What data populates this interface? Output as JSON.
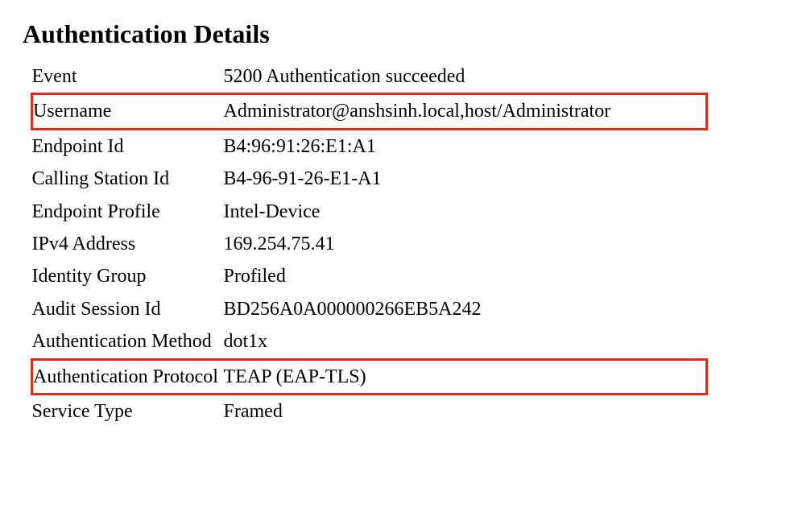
{
  "title": "Authentication Details",
  "rows": {
    "event": {
      "label": "Event",
      "value": "5200 Authentication succeeded"
    },
    "username": {
      "label": "Username",
      "value": "Administrator@anshsinh.local,host/Administrator"
    },
    "endpoint_id": {
      "label": "Endpoint Id",
      "value": "B4:96:91:26:E1:A1"
    },
    "calling_station": {
      "label": "Calling Station Id",
      "value": "B4-96-91-26-E1-A1"
    },
    "endpoint_profile": {
      "label": "Endpoint Profile",
      "value": "Intel-Device"
    },
    "ipv4": {
      "label": "IPv4 Address",
      "value": "169.254.75.41"
    },
    "identity_group": {
      "label": "Identity Group",
      "value": "Profiled"
    },
    "audit_session": {
      "label": "Audit Session Id",
      "value": "BD256A0A000000266EB5A242"
    },
    "auth_method": {
      "label": "Authentication Method",
      "value": "dot1x"
    },
    "auth_protocol": {
      "label": "Authentication Protocol",
      "value": "TEAP (EAP-TLS)"
    },
    "service_type": {
      "label": "Service Type",
      "value": "Framed"
    }
  },
  "colors": {
    "highlight_border": "#e22b1a",
    "success_text": "#148c1a"
  }
}
